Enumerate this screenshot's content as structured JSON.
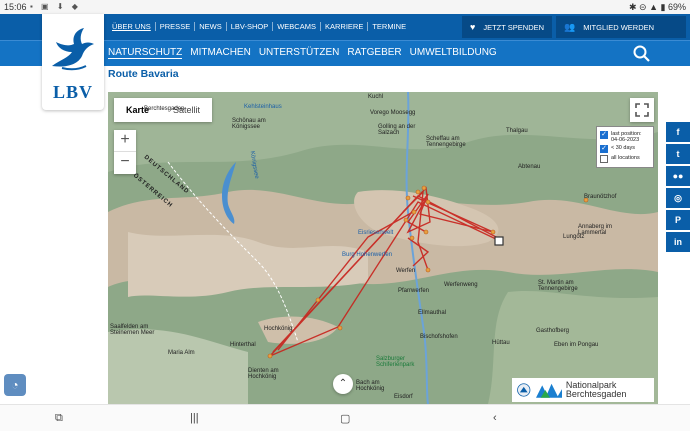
{
  "statusbar": {
    "time": "15:06",
    "icons": [
      "sim-icon",
      "image-icon",
      "download-icon",
      "notification-icon"
    ],
    "signal": "✱ ⊝ ▲ ▮",
    "battery": "69%"
  },
  "topnav": {
    "items": [
      "ÜBER UNS",
      "PRESSE",
      "NEWS",
      "LBV-SHOP",
      "WEBCAMS",
      "KARRIERE",
      "TERMINE"
    ],
    "spenden_label": "JETZT SPENDEN",
    "mitglied_label": "MITGLIED WERDEN"
  },
  "mainnav": {
    "items": [
      "NATURSCHUTZ",
      "MITMACHEN",
      "UNTERSTÜTZEN",
      "RATGEBER",
      "UMWELTBILDUNG"
    ]
  },
  "logo": {
    "text": "LBV"
  },
  "page": {
    "title": "Route Bavaria"
  },
  "map": {
    "type_buttons": [
      "Karte",
      "Satellit"
    ],
    "selected_type": "Karte",
    "zoom_in": "+",
    "zoom_out": "−",
    "legend": [
      {
        "label": "last position: 04-06-2023",
        "checked": true
      },
      {
        "label": "< 30 days",
        "checked": true
      },
      {
        "label": "all locations",
        "checked": false
      }
    ],
    "place_labels": [
      "Kuchl",
      "Berchtesgaden",
      "Schönau am Königssee",
      "Kehlsteinhaus",
      "Vorego Moosegg",
      "Golling an der Salzach",
      "Scheffau am Tennengebirge",
      "Thalgau",
      "Abtenau",
      "Braunötzhof",
      "Annaberg im Lammertal",
      "Lungötz",
      "Königssee",
      "DEUTSCHLAND",
      "ÖSTERREICH",
      "Eisriesenwelt",
      "Burg Hohenwerfen",
      "Werfen",
      "Pfarrwerfen",
      "Werfenweng",
      "St. Martin am Tennengebirge",
      "Ellmauthal",
      "Saalfelden am Steinernen Meer",
      "Maria Alm",
      "Hochkönig",
      "Hinterthal",
      "Bischofshofen",
      "Hüttau",
      "Gasthofberg",
      "Eben im Pongau",
      "Dienten am Hochkönig",
      "Salzburger Schiferienpark",
      "Bach am Hochkönig",
      "Eisdorf"
    ],
    "branding": "Nationalpark Berchtesgaden"
  },
  "social": [
    "f",
    "t",
    "●●",
    "◎",
    "P",
    "in"
  ],
  "colors": {
    "primary": "#0a5ea8",
    "nav": "#1473c4",
    "route": "#c8221c",
    "marker": "#e8a040"
  }
}
